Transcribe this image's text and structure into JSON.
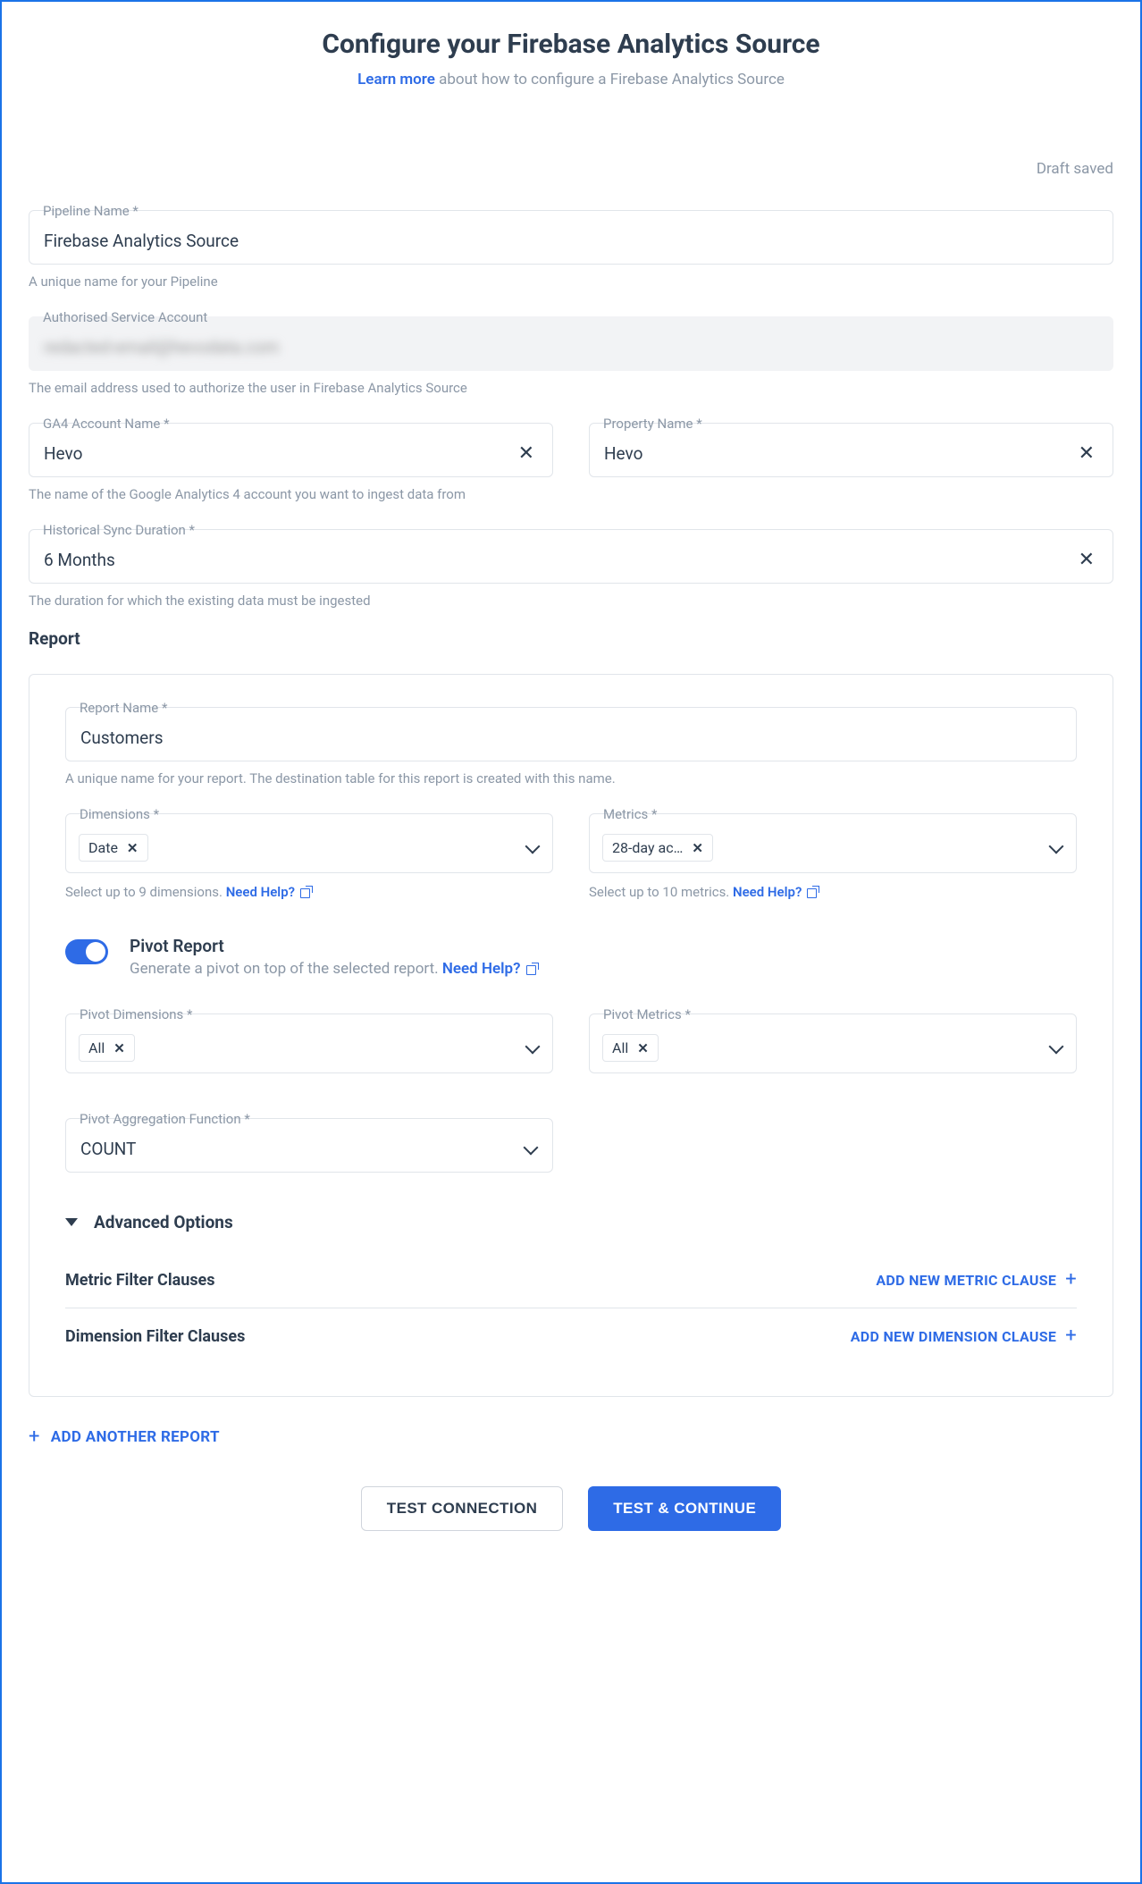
{
  "header": {
    "title": "Configure your Firebase Analytics Source",
    "learn_more": "Learn more",
    "subtitle_rest": " about how to configure a Firebase Analytics Source"
  },
  "draft_status": "Draft saved",
  "pipeline_name": {
    "label": "Pipeline Name *",
    "value": "Firebase Analytics Source",
    "helper": "A unique name for your Pipeline"
  },
  "service_account": {
    "label": "Authorised Service Account",
    "value_masked": "redacted-email@hevodata.com",
    "helper": "The email address used to authorize the user in Firebase Analytics Source"
  },
  "ga4_account": {
    "label": "GA4 Account Name *",
    "value": "Hevo",
    "helper": "The name of the Google Analytics 4 account you want to ingest data from"
  },
  "property": {
    "label": "Property Name *",
    "value": "Hevo"
  },
  "historical": {
    "label": "Historical Sync Duration *",
    "value": "6 Months",
    "helper": "The duration for which the existing data must be ingested"
  },
  "report_section": "Report",
  "report": {
    "name": {
      "label": "Report Name *",
      "value": "Customers",
      "helper": "A unique name for your report. The destination table for this report is created with this name."
    },
    "dimensions": {
      "label": "Dimensions *",
      "chip": "Date",
      "helper_prefix": "Select up to 9 dimensions. ",
      "help": "Need Help?"
    },
    "metrics": {
      "label": "Metrics *",
      "chip": "28-day ac…",
      "helper_prefix": "Select up to 10 metrics. ",
      "help": "Need Help?"
    },
    "pivot": {
      "title": "Pivot Report",
      "desc_prefix": "Generate a pivot on top of the selected report. ",
      "help": "Need Help?"
    },
    "pivot_dimensions": {
      "label": "Pivot Dimensions *",
      "chip": "All"
    },
    "pivot_metrics": {
      "label": "Pivot Metrics *",
      "chip": "All"
    },
    "pivot_agg": {
      "label": "Pivot Aggregation Function *",
      "value": "COUNT"
    },
    "advanced": "Advanced Options",
    "metric_clauses": "Metric Filter Clauses",
    "add_metric_clause": "ADD NEW METRIC CLAUSE",
    "dimension_clauses": "Dimension Filter Clauses",
    "add_dimension_clause": "ADD NEW DIMENSION CLAUSE"
  },
  "add_another_report": "ADD ANOTHER REPORT",
  "buttons": {
    "test_connection": "TEST CONNECTION",
    "test_continue": "TEST & CONTINUE"
  }
}
